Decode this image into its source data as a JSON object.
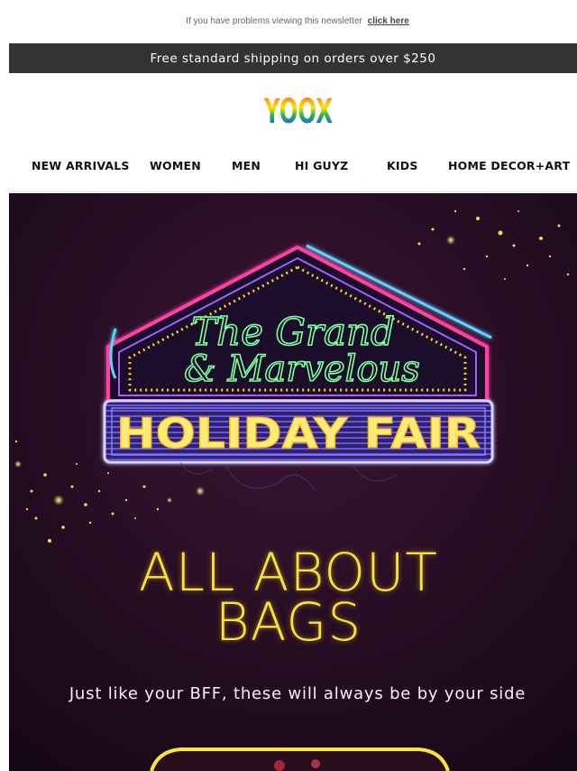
{
  "top_note": {
    "text": "If you have problems viewing this newsletter",
    "link": "click here"
  },
  "shipping_bar": {
    "text": "Free standard shipping on orders over $250",
    "bg": "#333333"
  },
  "logo": {
    "text": "YOOX",
    "colors": [
      "#e8232a",
      "#f7a21b",
      "#ffe600",
      "#2db34a",
      "#1f6fd1",
      "#8a2bd3"
    ]
  },
  "nav": {
    "items": [
      {
        "label": "NEW ARRIVALS"
      },
      {
        "label": "WOMEN"
      },
      {
        "label": "MEN"
      },
      {
        "label": "HI GUYZ"
      },
      {
        "label": "KIDS"
      },
      {
        "label": "HOME DECOR+ART"
      }
    ]
  },
  "hero": {
    "sign_script_line1": "The Grand",
    "sign_script_line2": "& Marvelous",
    "sign_title": "HOLIDAY FAIR",
    "headline_line1": "ALL ABOUT",
    "headline_line2": "BAGS",
    "subtitle": "Just like your BFF, these will always be by your side",
    "accent": "#f6e23a",
    "neon_green": "#7dff9a",
    "neon_pink": "#ff3fa4",
    "neon_blue": "#5fd0ff"
  }
}
